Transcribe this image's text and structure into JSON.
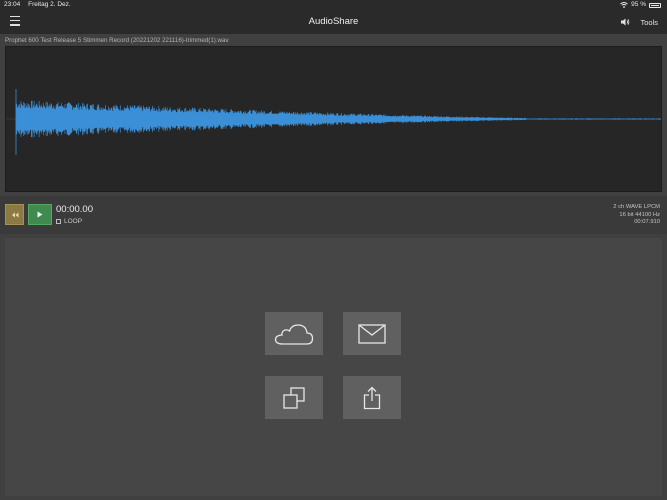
{
  "status": {
    "time": "23:04",
    "date": "Freitag 2. Dez.",
    "battery": "95 %"
  },
  "nav": {
    "title": "AudioShare",
    "tools_label": "Tools",
    "icons": [
      "menu-icon",
      "speaker-icon"
    ]
  },
  "file": {
    "name": "Prophet 600 Test Release 5 Stimmen Record (20221202 221116)-trimmed(1).wav"
  },
  "transport": {
    "time": "00:00.00",
    "loop_label": "LOOP",
    "format": "2 ch WAVE LPCM",
    "bitrate": "16 bit 44100 Hz",
    "duration": "00:07.910"
  },
  "actions": [
    {
      "name": "cloud",
      "icon": "cloud-icon"
    },
    {
      "name": "mail",
      "icon": "mail-icon"
    },
    {
      "name": "copy",
      "icon": "copy-icon"
    },
    {
      "name": "share",
      "icon": "share-icon"
    }
  ],
  "colors": {
    "waveform": "#3a8fd6",
    "play": "#3f8a4e",
    "rewind": "#8d7a43",
    "background": "#404040"
  }
}
